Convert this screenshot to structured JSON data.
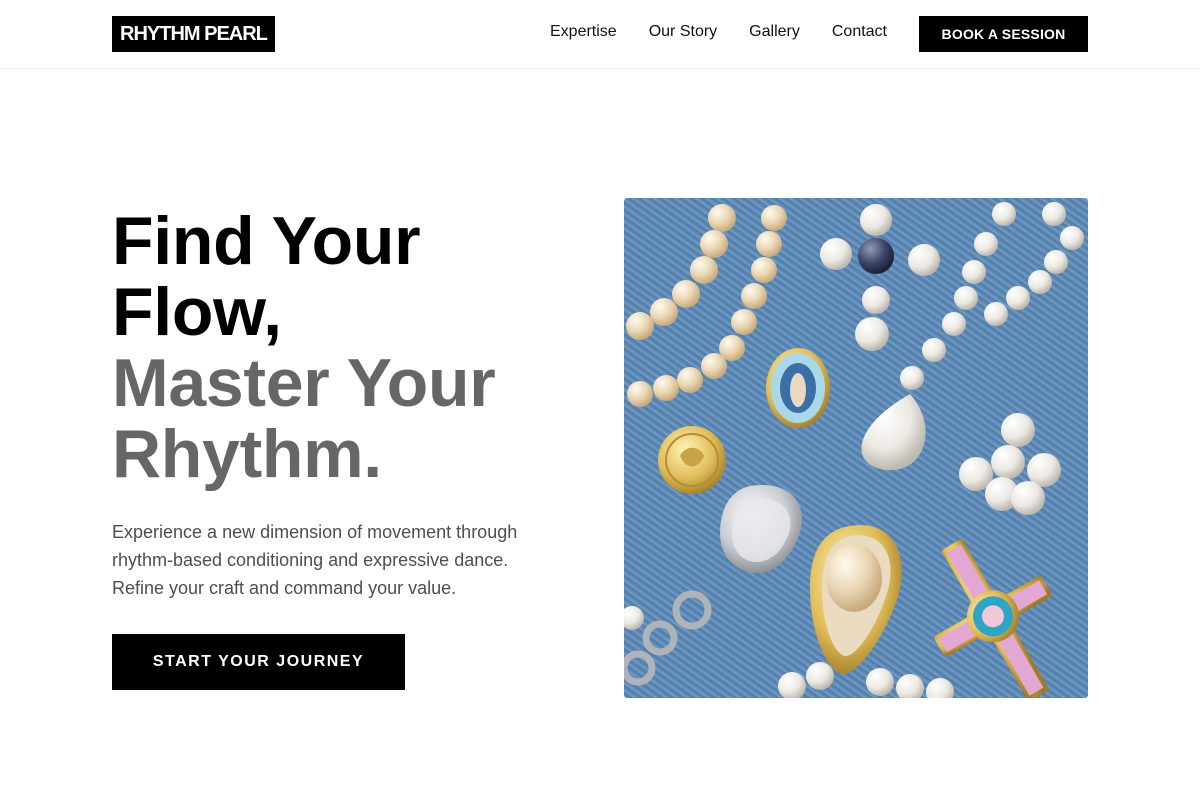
{
  "brand": {
    "logo_text": "RHYTHM PEARL"
  },
  "nav": {
    "items": [
      {
        "label": "Expertise"
      },
      {
        "label": "Our Story"
      },
      {
        "label": "Gallery"
      },
      {
        "label": "Contact"
      }
    ],
    "cta_label": "BOOK A SESSION"
  },
  "hero": {
    "title_line1": "Find Your",
    "title_line2": "Flow,",
    "title_line3": "Master Your",
    "title_line4": "Rhythm.",
    "description": "Experience a new dimension of movement through rhythm-based conditioning and expressive dance. Refine your craft and command your value.",
    "cta_label": "START YOUR JOURNEY"
  },
  "colors": {
    "accent": "#000000",
    "title_secondary": "#666666",
    "body_text": "#4a4f57",
    "denim": "#5b87b3"
  }
}
